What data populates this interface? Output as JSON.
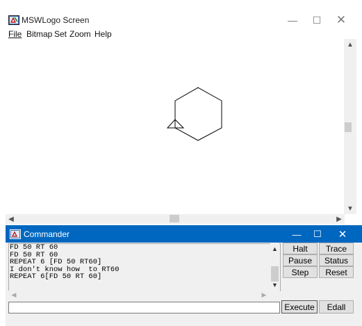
{
  "main_window": {
    "title": "MSWLogo Screen",
    "controls": {
      "minimize": "—",
      "maximize": "☐",
      "close": "✕"
    },
    "menu": [
      {
        "label": "File"
      },
      {
        "label": "Bitmap"
      },
      {
        "label": "Set"
      },
      {
        "label": "Zoom"
      },
      {
        "label": "Help"
      }
    ],
    "drawing": {
      "shape": "hexagon",
      "turtle": "triangle",
      "line_color": "#000000"
    }
  },
  "commander": {
    "title": "Commander",
    "controls": {
      "minimize": "—",
      "maximize": "☐",
      "close": "✕"
    },
    "history": "FD 50 RT 60\nFD 50 RT 60\nREPEAT 6 [FD 50 RT60]\nI don't know how  to RT60\nREPEAT 6[FD 50 RT 60]",
    "input_value": "",
    "buttons": {
      "halt": "Halt",
      "trace": "Trace",
      "pause": "Pause",
      "status": "Status",
      "step": "Step",
      "reset": "Reset",
      "execute": "Execute",
      "edall": "Edall"
    }
  },
  "colors": {
    "commander_titlebar": "#0067c0",
    "window_bg": "#f0f0f0"
  },
  "icons": {
    "app_icon": "logo-app-icon",
    "scroll_up": "▲",
    "scroll_down": "▼",
    "scroll_left": "◀",
    "scroll_right": "▶"
  }
}
